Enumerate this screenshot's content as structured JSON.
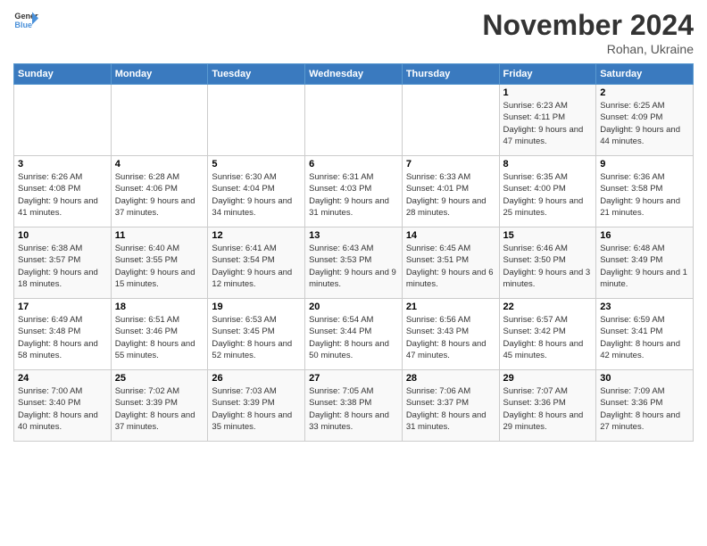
{
  "header": {
    "logo_line1": "General",
    "logo_line2": "Blue",
    "main_title": "November 2024",
    "subtitle": "Rohan, Ukraine"
  },
  "weekdays": [
    "Sunday",
    "Monday",
    "Tuesday",
    "Wednesday",
    "Thursday",
    "Friday",
    "Saturday"
  ],
  "weeks": [
    [
      {
        "day": "",
        "info": ""
      },
      {
        "day": "",
        "info": ""
      },
      {
        "day": "",
        "info": ""
      },
      {
        "day": "",
        "info": ""
      },
      {
        "day": "",
        "info": ""
      },
      {
        "day": "1",
        "info": "Sunrise: 6:23 AM\nSunset: 4:11 PM\nDaylight: 9 hours and 47 minutes."
      },
      {
        "day": "2",
        "info": "Sunrise: 6:25 AM\nSunset: 4:09 PM\nDaylight: 9 hours and 44 minutes."
      }
    ],
    [
      {
        "day": "3",
        "info": "Sunrise: 6:26 AM\nSunset: 4:08 PM\nDaylight: 9 hours and 41 minutes."
      },
      {
        "day": "4",
        "info": "Sunrise: 6:28 AM\nSunset: 4:06 PM\nDaylight: 9 hours and 37 minutes."
      },
      {
        "day": "5",
        "info": "Sunrise: 6:30 AM\nSunset: 4:04 PM\nDaylight: 9 hours and 34 minutes."
      },
      {
        "day": "6",
        "info": "Sunrise: 6:31 AM\nSunset: 4:03 PM\nDaylight: 9 hours and 31 minutes."
      },
      {
        "day": "7",
        "info": "Sunrise: 6:33 AM\nSunset: 4:01 PM\nDaylight: 9 hours and 28 minutes."
      },
      {
        "day": "8",
        "info": "Sunrise: 6:35 AM\nSunset: 4:00 PM\nDaylight: 9 hours and 25 minutes."
      },
      {
        "day": "9",
        "info": "Sunrise: 6:36 AM\nSunset: 3:58 PM\nDaylight: 9 hours and 21 minutes."
      }
    ],
    [
      {
        "day": "10",
        "info": "Sunrise: 6:38 AM\nSunset: 3:57 PM\nDaylight: 9 hours and 18 minutes."
      },
      {
        "day": "11",
        "info": "Sunrise: 6:40 AM\nSunset: 3:55 PM\nDaylight: 9 hours and 15 minutes."
      },
      {
        "day": "12",
        "info": "Sunrise: 6:41 AM\nSunset: 3:54 PM\nDaylight: 9 hours and 12 minutes."
      },
      {
        "day": "13",
        "info": "Sunrise: 6:43 AM\nSunset: 3:53 PM\nDaylight: 9 hours and 9 minutes."
      },
      {
        "day": "14",
        "info": "Sunrise: 6:45 AM\nSunset: 3:51 PM\nDaylight: 9 hours and 6 minutes."
      },
      {
        "day": "15",
        "info": "Sunrise: 6:46 AM\nSunset: 3:50 PM\nDaylight: 9 hours and 3 minutes."
      },
      {
        "day": "16",
        "info": "Sunrise: 6:48 AM\nSunset: 3:49 PM\nDaylight: 9 hours and 1 minute."
      }
    ],
    [
      {
        "day": "17",
        "info": "Sunrise: 6:49 AM\nSunset: 3:48 PM\nDaylight: 8 hours and 58 minutes."
      },
      {
        "day": "18",
        "info": "Sunrise: 6:51 AM\nSunset: 3:46 PM\nDaylight: 8 hours and 55 minutes."
      },
      {
        "day": "19",
        "info": "Sunrise: 6:53 AM\nSunset: 3:45 PM\nDaylight: 8 hours and 52 minutes."
      },
      {
        "day": "20",
        "info": "Sunrise: 6:54 AM\nSunset: 3:44 PM\nDaylight: 8 hours and 50 minutes."
      },
      {
        "day": "21",
        "info": "Sunrise: 6:56 AM\nSunset: 3:43 PM\nDaylight: 8 hours and 47 minutes."
      },
      {
        "day": "22",
        "info": "Sunrise: 6:57 AM\nSunset: 3:42 PM\nDaylight: 8 hours and 45 minutes."
      },
      {
        "day": "23",
        "info": "Sunrise: 6:59 AM\nSunset: 3:41 PM\nDaylight: 8 hours and 42 minutes."
      }
    ],
    [
      {
        "day": "24",
        "info": "Sunrise: 7:00 AM\nSunset: 3:40 PM\nDaylight: 8 hours and 40 minutes."
      },
      {
        "day": "25",
        "info": "Sunrise: 7:02 AM\nSunset: 3:39 PM\nDaylight: 8 hours and 37 minutes."
      },
      {
        "day": "26",
        "info": "Sunrise: 7:03 AM\nSunset: 3:39 PM\nDaylight: 8 hours and 35 minutes."
      },
      {
        "day": "27",
        "info": "Sunrise: 7:05 AM\nSunset: 3:38 PM\nDaylight: 8 hours and 33 minutes."
      },
      {
        "day": "28",
        "info": "Sunrise: 7:06 AM\nSunset: 3:37 PM\nDaylight: 8 hours and 31 minutes."
      },
      {
        "day": "29",
        "info": "Sunrise: 7:07 AM\nSunset: 3:36 PM\nDaylight: 8 hours and 29 minutes."
      },
      {
        "day": "30",
        "info": "Sunrise: 7:09 AM\nSunset: 3:36 PM\nDaylight: 8 hours and 27 minutes."
      }
    ]
  ]
}
